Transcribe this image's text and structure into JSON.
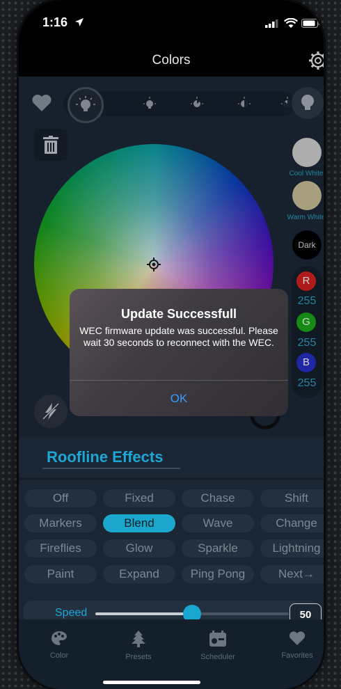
{
  "status_bar": {
    "time": "1:16"
  },
  "nav": {
    "title": "Colors"
  },
  "swatches": {
    "cool_white": "Cool White",
    "warm_white": "Warm White",
    "dark": "Dark"
  },
  "rgb": {
    "r_label": "R",
    "r_value": "255",
    "g_label": "G",
    "g_value": "255",
    "b_label": "B",
    "b_value": "255"
  },
  "alert": {
    "title": "Update Successfull",
    "message": "WEC firmware update was successful. Please wait 30 seconds to reconnect with the WEC.",
    "ok": "OK"
  },
  "effects": {
    "title": "Roofline Effects",
    "items": [
      "Off",
      "Fixed",
      "Chase",
      "Shift",
      "Markers",
      "Blend",
      "Wave",
      "Change",
      "Fireflies",
      "Glow",
      "Sparkle",
      "Lightning",
      "Paint",
      "Expand",
      "Ping Pong",
      "Next"
    ],
    "selected": "Blend"
  },
  "speed": {
    "label": "Speed",
    "value": "50",
    "level": 0.5
  },
  "tabs": [
    "Color",
    "Presets",
    "Scheduler",
    "Favorites"
  ],
  "colors": {
    "accent": "#1ba7cc",
    "panel": "#1a2633",
    "alert_button": "#3d9cff"
  }
}
